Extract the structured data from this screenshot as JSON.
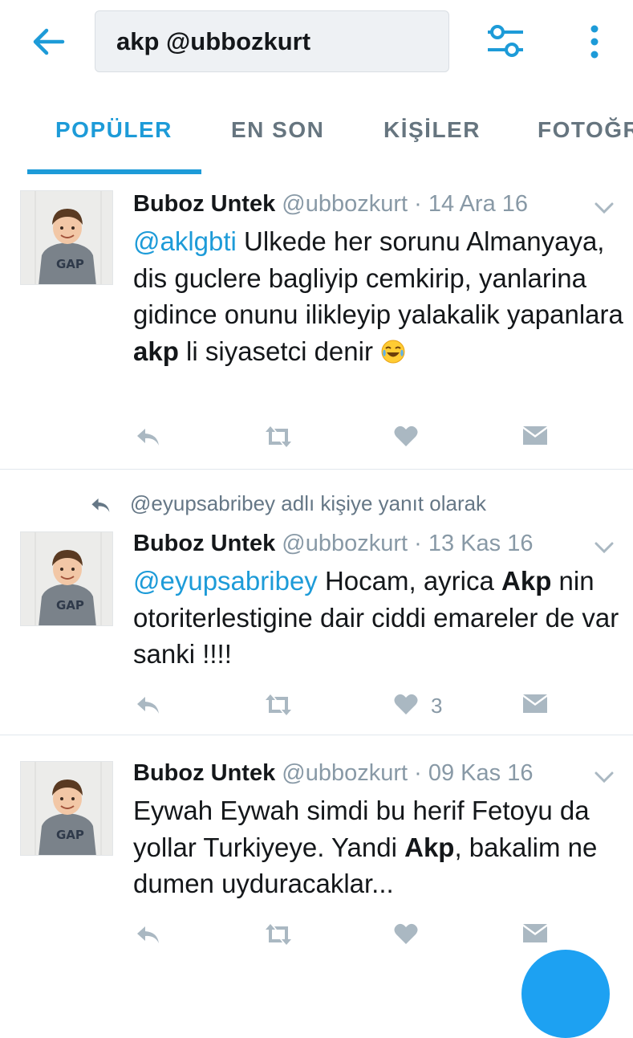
{
  "search": {
    "query": "akp @ubbozkurt"
  },
  "tabs": [
    {
      "label": "POPÜLER",
      "active": true
    },
    {
      "label": "EN SON",
      "active": false
    },
    {
      "label": "KİŞİLER",
      "active": false
    },
    {
      "label": "FOTOĞRAFLAR",
      "active": false
    }
  ],
  "tweets": [
    {
      "name": "Buboz Untek",
      "handle": "@ubbozkurt",
      "date": "· 14 Ara 16",
      "reply_context": "",
      "text_parts": [
        {
          "text": "@aklgbti",
          "style": "mention"
        },
        {
          "text": " Ulkede her sorunu Almanyaya, dis guclere bagliyip cemkirip, yanlarina gidince onunu ilikleyip yalakalik yapanlara ",
          "style": "plain"
        },
        {
          "text": "akp",
          "style": "bold"
        },
        {
          "text": " li siyasetci denir ",
          "style": "plain"
        }
      ],
      "emoji": "tears-of-joy-emoji",
      "likes": ""
    },
    {
      "name": "Buboz Untek",
      "handle": "@ubbozkurt",
      "date": "· 13 Kas 16",
      "reply_context": "@eyupsabribey adlı kişiye yanıt olarak",
      "text_parts": [
        {
          "text": "@eyupsabribey",
          "style": "mention"
        },
        {
          "text": " Hocam, ayrica ",
          "style": "plain"
        },
        {
          "text": "Akp",
          "style": "bold"
        },
        {
          "text": " nin otoriterlestigine dair ciddi emareler de var sanki !!!!",
          "style": "plain"
        }
      ],
      "emoji": "",
      "likes": "3"
    },
    {
      "name": "Buboz Untek",
      "handle": "@ubbozkurt",
      "date": "· 09 Kas 16",
      "reply_context": "",
      "text_parts": [
        {
          "text": "Eywah Eywah simdi bu herif Fetoyu da yollar Turkiyeye. Yandi ",
          "style": "plain"
        },
        {
          "text": "Akp",
          "style": "bold"
        },
        {
          "text": ", bakalim ne dumen uyduracaklar...",
          "style": "plain"
        }
      ],
      "emoji": "",
      "likes": ""
    }
  ],
  "colors": {
    "accent": "#1d9bd8",
    "muted": "#8899a6",
    "text": "#14171a"
  }
}
